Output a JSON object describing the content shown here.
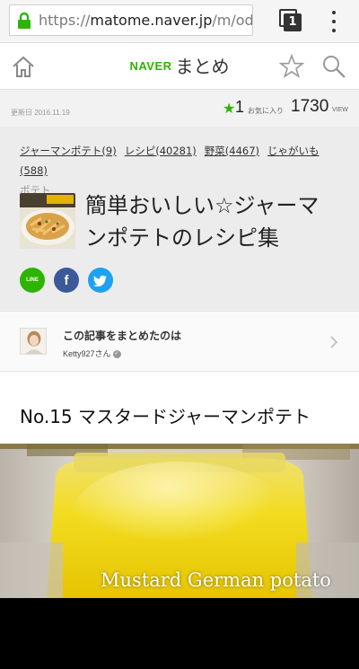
{
  "browser": {
    "url_host": "matome.naver.jp",
    "url_scheme": "https://",
    "url_path": "/m/oda",
    "tab_count": "1"
  },
  "site": {
    "brand": "NAVER",
    "product": "まとめ"
  },
  "meta": {
    "updated": "更新日 2016.11.19",
    "favorites_count": "1",
    "favorites_label": "お気に入り",
    "view_count": "1730",
    "view_label": "VIEW"
  },
  "article": {
    "tags": [
      "ジャーマンポテト(9)",
      "レシピ(40281)",
      "野菜(4467)",
      "じゃがいも(588)",
      "ポテト"
    ],
    "title": "簡単おいしい☆ジャーマンポテトのレシピ集",
    "share": {
      "line": "LINE",
      "facebook": "f"
    }
  },
  "curator": {
    "heading": "この記事をまとめたのは",
    "name": "Ketty927",
    "suffix": "さん"
  },
  "section": {
    "title": "No.15 マスタードジャーマンポテト",
    "image_caption": "Mustard German potato"
  },
  "colors": {
    "naver_green": "#2db400",
    "facebook": "#3b5998",
    "twitter": "#1da1f2"
  }
}
